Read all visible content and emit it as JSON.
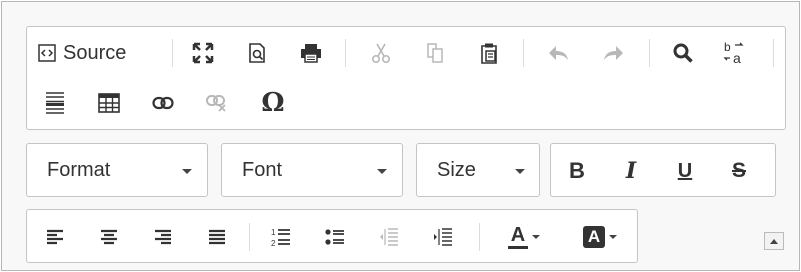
{
  "toolbar": {
    "row1": {
      "source_label": "Source",
      "icons": [
        "source-icon",
        "maximize-icon",
        "preview-icon",
        "print-icon",
        "cut-icon",
        "copy-icon",
        "paste-icon",
        "undo-icon",
        "redo-icon",
        "find-icon",
        "replace-icon"
      ]
    },
    "row2": {
      "icons": [
        "horizontal-rule-icon",
        "table-icon",
        "link-icon",
        "unlink-icon",
        "omega-icon"
      ],
      "special_char": "Ω"
    },
    "row3": {
      "format_label": "Format",
      "font_label": "Font",
      "size_label": "Size",
      "bold": "B",
      "italic": "I",
      "underline": "U",
      "strike": "S"
    },
    "row4": {
      "text_color_glyph": "A",
      "bg_color_glyph": "A",
      "icons": [
        "align-left-icon",
        "align-center-icon",
        "align-right-icon",
        "justify-icon",
        "numbered-list-icon",
        "bulleted-list-icon",
        "outdent-icon",
        "indent-icon",
        "text-color-icon",
        "background-color-icon",
        "collapse-toolbar-icon"
      ]
    }
  },
  "colors": {
    "icon": "#333333",
    "disabled": "#b8b8b8",
    "border": "#c4c4c4",
    "bg": "#f8f8f8"
  }
}
